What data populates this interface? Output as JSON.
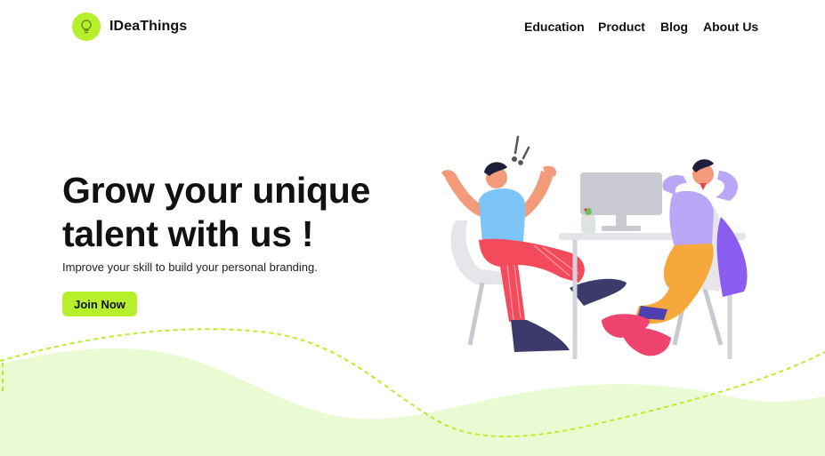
{
  "header": {
    "brand": "IDeaThings",
    "logo_icon": "lightbulb-icon",
    "nav": [
      {
        "label": "Education"
      },
      {
        "label": "Product"
      },
      {
        "label": "Blog"
      },
      {
        "label": "About Us"
      }
    ]
  },
  "hero": {
    "title_line1": "Grow your unique",
    "title_line2": "talent with us !",
    "subtitle": "Improve your skill to build your personal branding.",
    "cta_label": "Join Now"
  },
  "colors": {
    "accent": "#b6f02a",
    "wave": "#eafad2",
    "text": "#111111"
  }
}
